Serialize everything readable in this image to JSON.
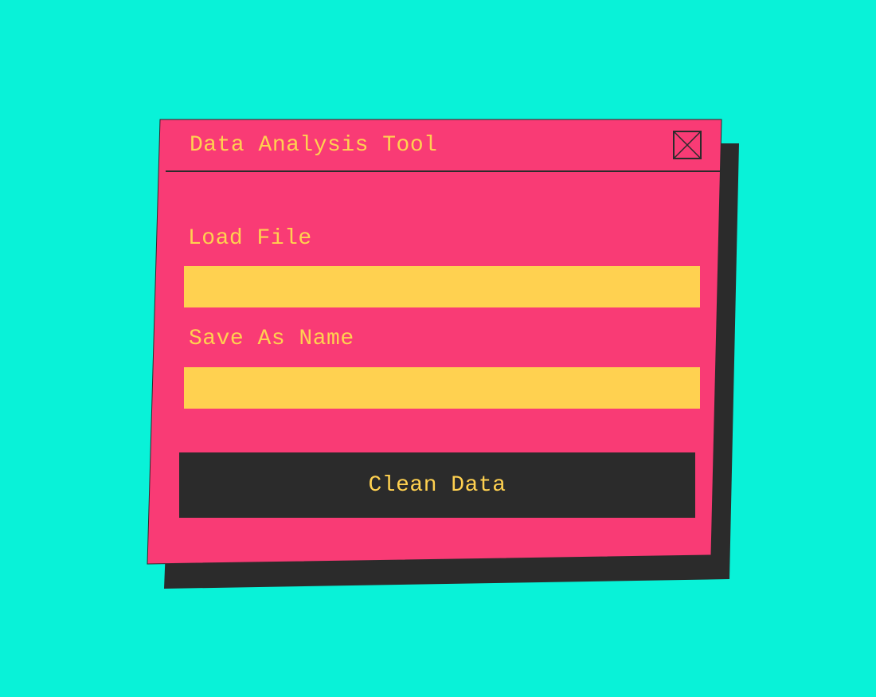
{
  "colors": {
    "background": "#09f2d8",
    "panel": "#f93b75",
    "shadow": "#2b2b2b",
    "accent_text": "#ffd150",
    "input_fill": "#ffd150",
    "button_fill": "#2b2b2b",
    "line": "#2b2b2b"
  },
  "dialog": {
    "title": "Data Analysis Tool",
    "close_icon": "close-x-icon"
  },
  "form": {
    "load_label": "Load File",
    "load_value": "",
    "save_label": "Save As Name",
    "save_value": ""
  },
  "action": {
    "label": "Clean Data"
  }
}
